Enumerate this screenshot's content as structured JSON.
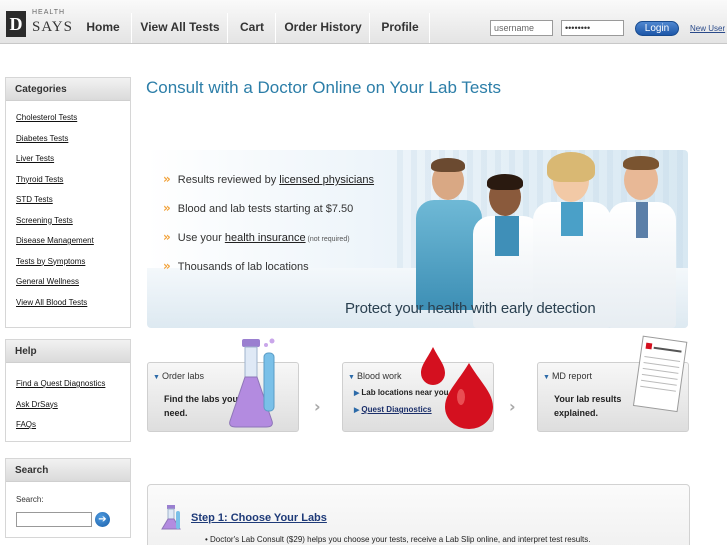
{
  "brand": {
    "health": "HEALTH",
    "says": "SAYS",
    "mark": "D"
  },
  "nav": {
    "items": [
      "Home",
      "View All Tests",
      "Cart",
      "Order History",
      "Profile"
    ]
  },
  "login": {
    "username_value": "username",
    "password_value": "••••••••",
    "button": "Login",
    "new_user": "New User"
  },
  "sidebar": {
    "categories": {
      "title": "Categories",
      "items": [
        "Cholesterol Tests",
        "Diabetes Tests",
        "Liver Tests",
        "Thyroid Tests",
        "STD Tests",
        "Screening Tests",
        "Disease Management",
        "Tests by Symptoms",
        "General Wellness",
        "View All Blood Tests"
      ]
    },
    "help": {
      "title": "Help",
      "items": [
        "Find a Quest Diagnostics",
        "Ask DrSays",
        "FAQs"
      ]
    },
    "search": {
      "title": "Search",
      "label": "Search:",
      "go": "➔"
    }
  },
  "main": {
    "title": "Consult with a Doctor Online on Your Lab Tests",
    "hero": {
      "b1_pre": "Results reviewed by ",
      "b1_link": "licensed physicians",
      "b2": "Blood and lab tests starting at $7.50",
      "b3_pre": "Use your ",
      "b3_link": "health insurance",
      "b3_note": " (not required)",
      "b4": "Thousands of lab locations",
      "tagline": "Protect your health with early detection"
    },
    "steps": [
      {
        "label": "Order labs",
        "line1": "Find the labs you",
        "line2": "need."
      },
      {
        "label": "Blood work",
        "item1": "Lab locations near you",
        "item2": "Quest Diagnostics"
      },
      {
        "label": "MD report",
        "line1": "Your lab results",
        "line2": "explained."
      }
    ],
    "step_detail": {
      "heading": "Step 1: Choose Your Labs",
      "text": "• Doctor's Lab Consult ($29) helps you choose your tests, receive a Lab Slip online, and interpret test results."
    }
  },
  "colors": {
    "accent": "#2c7ea8",
    "chevron": "#f2a23a",
    "link": "#1e3a78",
    "button": "#1d57a8"
  }
}
